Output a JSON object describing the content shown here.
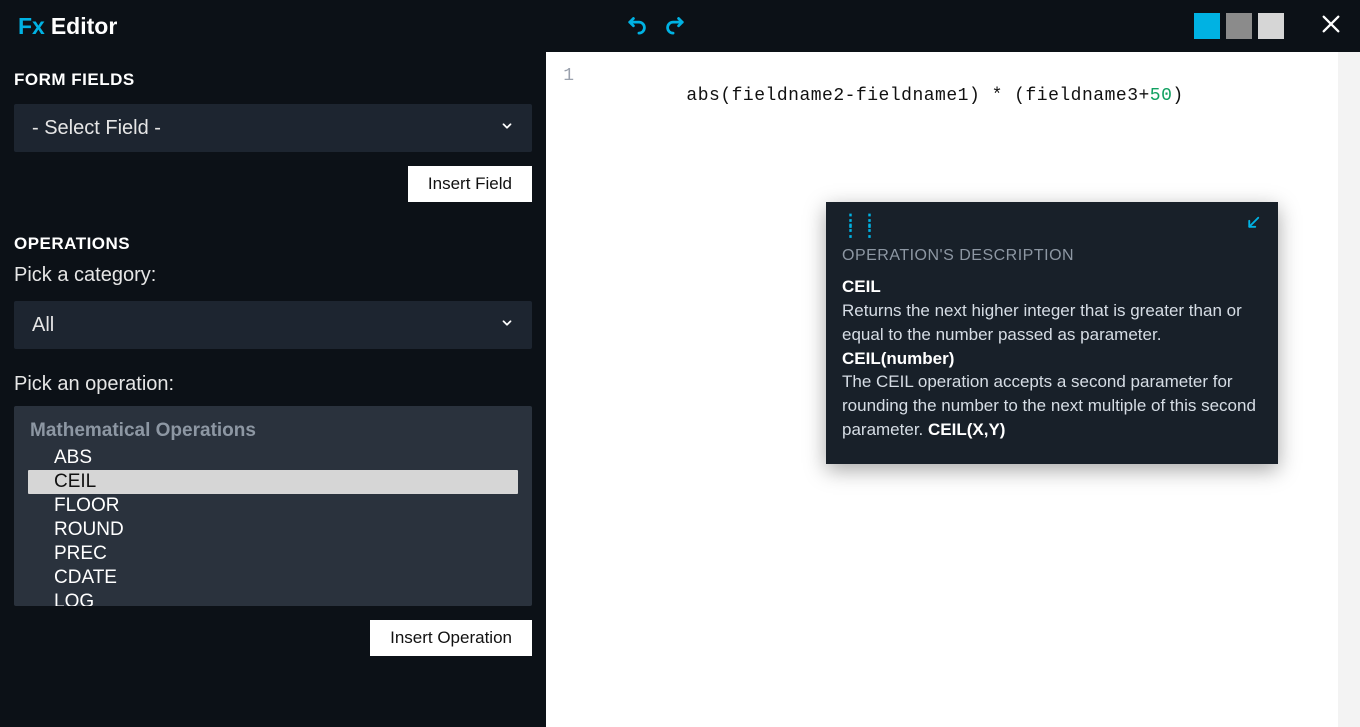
{
  "titlebar": {
    "fx": "Fx",
    "title": "Editor"
  },
  "colors": {
    "accent": "#00B2E3",
    "swatch2": "#8b8b8b",
    "swatch3": "#d6d6d6"
  },
  "form_fields": {
    "label": "FORM FIELDS",
    "select_value": "- Select Field -",
    "insert_btn": "Insert Field"
  },
  "operations": {
    "label": "OPERATIONS",
    "pick_category_label": "Pick a category:",
    "category_value": "All",
    "pick_operation_label": "Pick an operation:",
    "category_header": "Mathematical Operations",
    "items": [
      "ABS",
      "CEIL",
      "FLOOR",
      "ROUND",
      "PREC",
      "CDATE",
      "LOG"
    ],
    "selected_index": 1,
    "insert_btn": "Insert Operation"
  },
  "editor": {
    "line_number": "1",
    "code_prefix": "abs(fieldname2-fieldname1) * (fieldname3+",
    "code_number": "50",
    "code_suffix": ")"
  },
  "description": {
    "header": "OPERATION'S DESCRIPTION",
    "name": "CEIL",
    "text1": "Returns the next higher integer that is greater than or equal to the number passed as parameter.",
    "signature": "CEIL(number)",
    "text2_a": "The CEIL operation accepts a second parameter for rounding the number to the next multiple of this second parameter. ",
    "text2_b": "CEIL(X,Y)"
  }
}
